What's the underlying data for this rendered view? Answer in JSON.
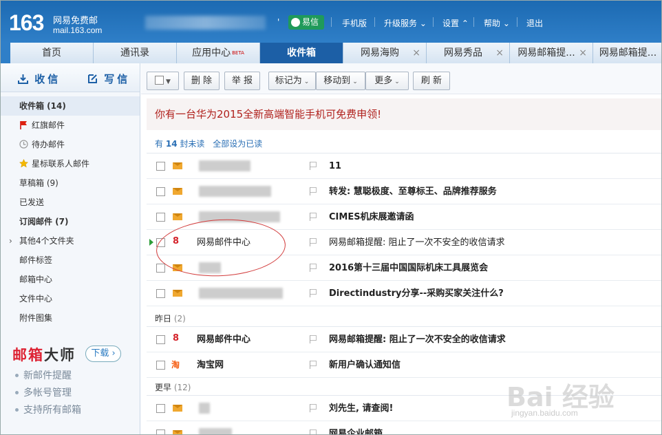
{
  "logo": {
    "number": "163",
    "name": "网易免费邮",
    "domain": "mail.163.com"
  },
  "header": {
    "separator": "'",
    "yixin": "易信",
    "links": [
      "手机版",
      "升级服务",
      "设置",
      "帮助",
      "退出"
    ]
  },
  "tabs": [
    {
      "label": "首页"
    },
    {
      "label": "通讯录"
    },
    {
      "label": "应用中心",
      "badge": "BETA"
    },
    {
      "label": "收件箱",
      "active": true
    },
    {
      "label": "网易海购",
      "closable": true
    },
    {
      "label": "网易秀品",
      "closable": true
    },
    {
      "label": "网易邮箱提...",
      "closable": true
    },
    {
      "label": "网易邮箱提...",
      "closable": true
    }
  ],
  "sidebar": {
    "receive": "收信",
    "compose": "写信",
    "items": [
      {
        "label": "收件箱 (14)",
        "active": true
      },
      {
        "label": "红旗邮件",
        "icon": "red-flag-icon"
      },
      {
        "label": "待办邮件",
        "icon": "clock-icon"
      },
      {
        "label": "星标联系人邮件",
        "icon": "star-icon"
      },
      {
        "label": "草稿箱 (9)"
      },
      {
        "label": "已发送"
      },
      {
        "label": "订阅邮件 (7)"
      },
      {
        "label": "其他4个文件夹"
      },
      {
        "label": "邮件标签"
      },
      {
        "label": "邮箱中心"
      },
      {
        "label": "文件中心"
      },
      {
        "label": "附件图集"
      }
    ],
    "master": {
      "title_red": "邮箱",
      "title_dark": "大师",
      "download": "下载",
      "features": [
        "新邮件提醒",
        "多帐号管理",
        "支持所有邮箱"
      ]
    }
  },
  "toolbar": {
    "delete": "删 除",
    "report": "举 报",
    "mark_as": "标记为",
    "move_to": "移动到",
    "more": "更多",
    "refresh": "刷 新"
  },
  "banner": "你有一台华为2015全新高端智能手机可免费申领!",
  "unread": {
    "prefix": "有",
    "count": "14",
    "suffix": "封未读",
    "mark_all": "全部设为已读"
  },
  "groups": {
    "yesterday": {
      "label": "昨日",
      "count": "(2)"
    },
    "earlier": {
      "label": "更早",
      "count": "(12)"
    }
  },
  "emails": [
    {
      "sender": "",
      "subject": "11",
      "unread": true,
      "icon": "envelope-icon"
    },
    {
      "sender": "",
      "subject": "转发: 慧聪极度、至尊标王、品牌推荐服务",
      "unread": true,
      "icon": "envelope-icon"
    },
    {
      "sender": "",
      "subject": "CIMES机床展邀请函",
      "unread": true,
      "icon": "envelope-icon"
    },
    {
      "sender": "网易邮件中心",
      "subject": "网易邮箱提醒: 阻止了一次不安全的收信请求",
      "unread": false,
      "icon": "netease-163-icon"
    },
    {
      "sender": "",
      "subject": "2016第十三届中国国际机床工具展览会",
      "unread": true,
      "icon": "envelope-icon"
    },
    {
      "sender": "",
      "subject": "Directindustry分享--采购买家关注什么?",
      "unread": true,
      "icon": "envelope-icon"
    },
    {
      "sender": "网易邮件中心",
      "subject": "网易邮箱提醒: 阻止了一次不安全的收信请求",
      "unread": true,
      "icon": "netease-163-icon"
    },
    {
      "sender": "淘宝网",
      "subject": "新用户确认通知信",
      "unread": true,
      "icon": "taobao-icon"
    },
    {
      "sender": "",
      "subject": "刘先生, 请查阅!",
      "unread": true,
      "icon": "envelope-icon"
    },
    {
      "sender": "",
      "subject": "网易企业邮箱",
      "unread": true,
      "icon": "envelope-icon"
    }
  ],
  "watermark": {
    "main": "Bai 经验",
    "sub": "jingyan.baidu.com"
  },
  "icons": {
    "netease": "8",
    "taobao": "淘"
  },
  "colors": {
    "header_blue": "#2f7fc8",
    "banner_red": "#b0211d",
    "annotation_red": "#d23c3c"
  }
}
